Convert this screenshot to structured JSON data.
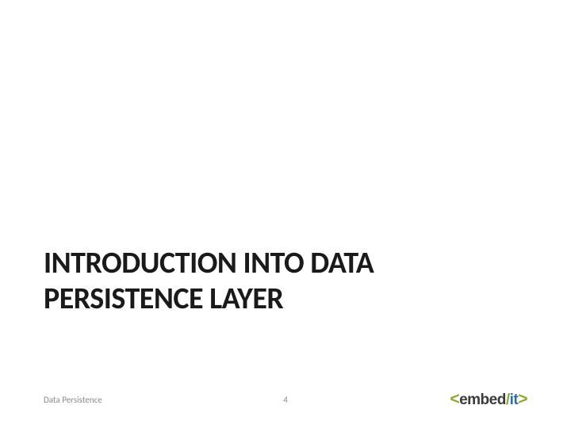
{
  "slide": {
    "heading": "INTRODUCTION INTO DATA PERSISTENCE LAYER"
  },
  "footer": {
    "left": "Data Persistence",
    "page_number": "4"
  },
  "logo": {
    "open": "<",
    "embed": "embed",
    "slash": "/",
    "it": "it",
    "close": ">"
  }
}
